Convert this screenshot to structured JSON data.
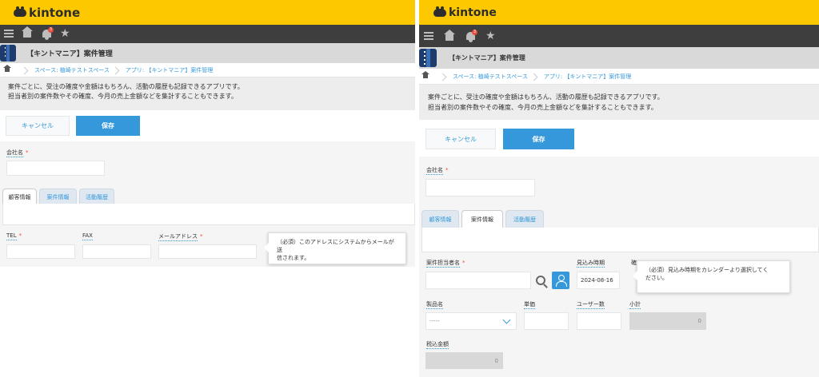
{
  "left": {
    "logo": "kintone",
    "notification_count": "3",
    "app_title": "【キントマニア】案件管理",
    "breadcrumb": {
      "space": "スペース: 植崎テストスペース",
      "app": "アプリ: 【キントマニア】案件管理"
    },
    "description": [
      "案件ごとに、受注の確度や金額はもちろん、活動の履歴も記録できるアプリです。",
      "担当者別の案件数やその確度、今月の売上金額などを集計することもできます。"
    ],
    "cancel_label": "キャンセル",
    "save_label": "保存",
    "company_label": "会社名",
    "required_mark": "*",
    "tabs": [
      "顧客情報",
      "案件情報",
      "活動履歴"
    ],
    "tel_label": "TEL",
    "fax_label": "FAX",
    "email_label": "メールアドレス",
    "tooltip": [
      "（必須）このアドレスにシステムからメールが送",
      "信されます。"
    ]
  },
  "right": {
    "logo": "kintone",
    "notification_count": "3",
    "app_title": "【キントマニア】案件管理",
    "breadcrumb": {
      "space": "スペース: 植崎テストスペース",
      "app": "アプリ: 【キントマニア】案件管理"
    },
    "description": [
      "案件ごとに、受注の確度や金額はもちろん、活動の履歴も記録できるアプリです。",
      "担当者別の案件数やその確度、今月の売上金額などを集計することもできます。"
    ],
    "cancel_label": "キャンセル",
    "save_label": "保存",
    "company_label": "会社名",
    "required_mark": "*",
    "tabs": [
      "顧客情報",
      "案件情報",
      "活動履歴"
    ],
    "owner_label": "案件担当者名",
    "expected_label": "見込み時期",
    "expected_value": "2024-08-16",
    "certainty_label_partial": "確",
    "tooltip": [
      "（必須）見込み時期をカレンダーより選択してく",
      "ださい。"
    ],
    "product_label": "製品名",
    "product_value": "-----",
    "unit_price_label": "単価",
    "users_label": "ユーザー数",
    "subtotal_label": "小計",
    "subtotal_value": "0",
    "total_tax_label": "税込金額",
    "total_tax_value": "0"
  },
  "colors": {
    "brand_yellow": "#fdc800",
    "global_bar": "#3e3e3e",
    "accent_blue": "#3498db",
    "required_red": "#e74c3c"
  }
}
